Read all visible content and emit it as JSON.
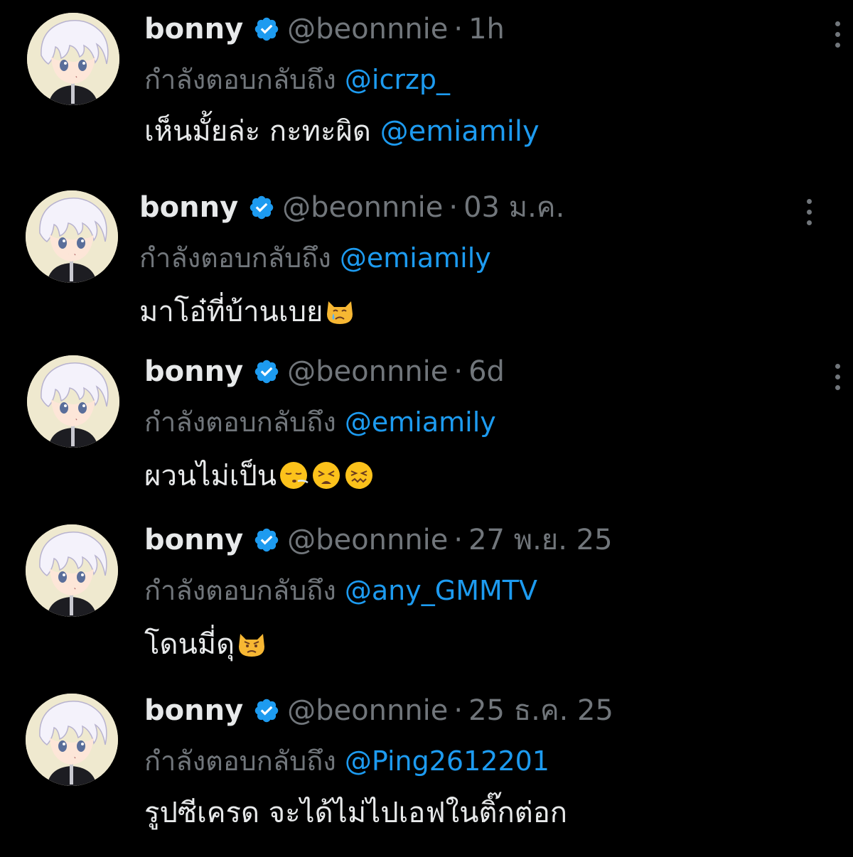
{
  "reply_prefix": "กำลังตอบกลับถึง",
  "separator": "·",
  "colors": {
    "background": "#000000",
    "text": "#e7e9ea",
    "muted": "#71767b",
    "accent": "#1d9bf0",
    "verified": "#1d9bf0"
  },
  "tweets": [
    {
      "name": "bonny",
      "verified_icon": "verified-badge-icon",
      "handle": "@beonnnie",
      "time": "1h",
      "reply_to": "@icrzp_",
      "text": "เห็นมั้ยล่ะ กะทะผิด",
      "text_mention": "@emiamily",
      "emojis": []
    },
    {
      "name": "bonny",
      "verified_icon": "verified-badge-icon",
      "handle": "@beonnnie",
      "time": "03 ม.ค.",
      "reply_to": "@emiamily",
      "text": "มาโอ๋ที่บ้านเบย",
      "text_mention": "",
      "emojis": [
        "crying-cat-face-emoji"
      ]
    },
    {
      "name": "bonny",
      "verified_icon": "verified-badge-icon",
      "handle": "@beonnnie",
      "time": "6d",
      "reply_to": "@emiamily",
      "text": "ผวนไม่เป็น",
      "text_mention": "",
      "emojis": [
        "face-exhaling-emoji",
        "tired-face-emoji",
        "confounded-face-emoji"
      ]
    },
    {
      "name": "bonny",
      "verified_icon": "verified-badge-icon",
      "handle": "@beonnnie",
      "time": "27 พ.ย. 25",
      "reply_to": "@any_GMMTV",
      "text": "โดนมี่ดุ",
      "text_mention": "",
      "emojis": [
        "pouting-cat-face-emoji"
      ]
    },
    {
      "name": "bonny",
      "verified_icon": "verified-badge-icon",
      "handle": "@beonnnie",
      "time": "25 ธ.ค. 25",
      "reply_to": "@Ping2612201",
      "text": "รูปซีเครด จะได้ไม่ไปเอฟในติ๊กต่อก",
      "text_mention": "",
      "emojis": []
    }
  ]
}
